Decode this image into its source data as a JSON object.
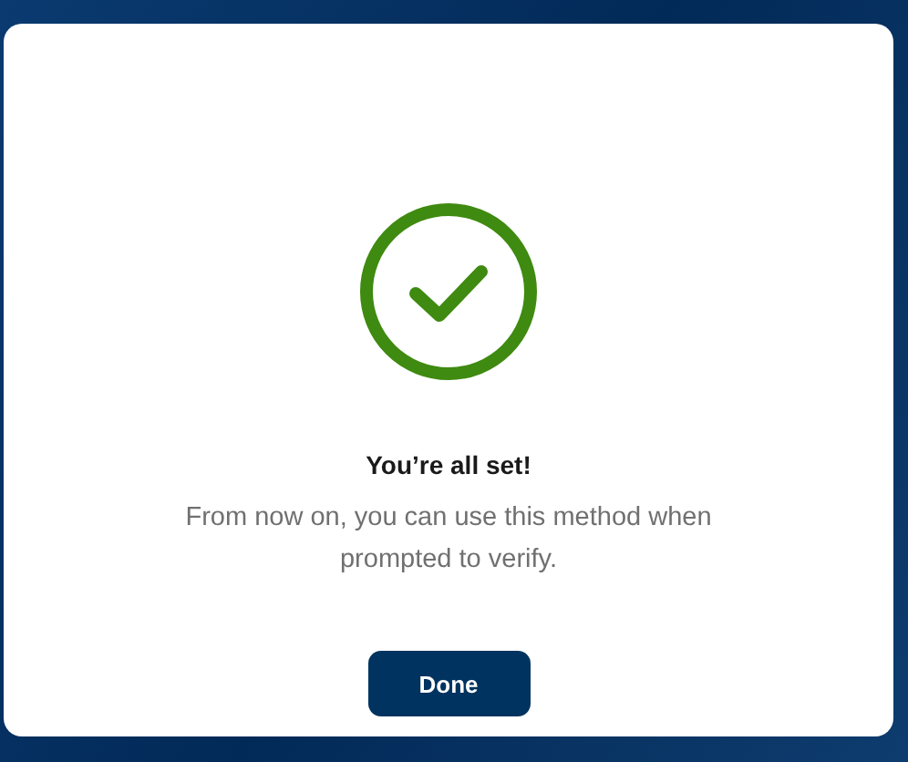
{
  "dialog": {
    "title": "You’re all set!",
    "message": "From now on, you can use this method when prompted to verify.",
    "buttons": [
      "Done"
    ]
  }
}
